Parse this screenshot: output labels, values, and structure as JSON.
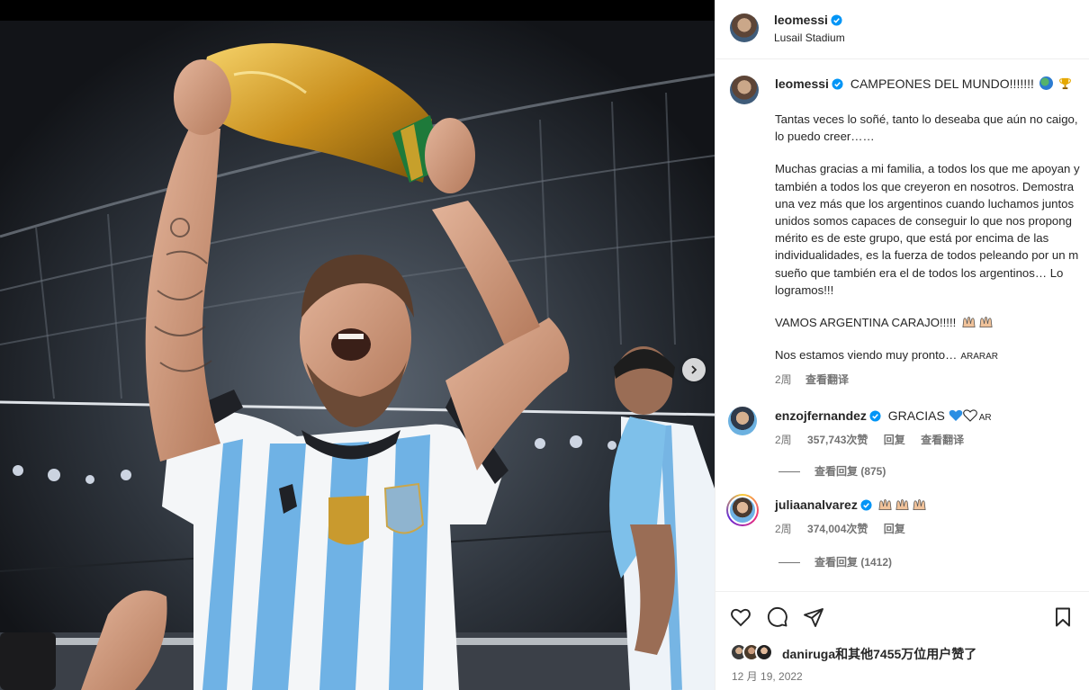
{
  "post": {
    "author": "leomessi",
    "location": "Lusail Stadium",
    "caption_title": "CAMPEONES DEL MUNDO!!!!!!!",
    "caption_lines": [
      "Tantas veces lo soñé, tanto lo deseaba que aún no caigo,",
      "lo puedo creer……",
      "",
      "Muchas gracias a mi familia, a todos los que me apoyan y",
      "también a todos los que creyeron en nosotros. Demostra",
      "una vez más que los argentinos cuando luchamos juntos",
      "unidos somos capaces de conseguir lo que nos propong",
      "mérito es de este grupo, que está por encima de las",
      "individualidades, es la fuerza de todos peleando por un m",
      "sueño que también era el de todos los argentinos… Lo",
      "logramos!!!",
      "",
      "VAMOS ARGENTINA CARAJO!!!!!",
      "",
      "Nos estamos viendo muy pronto…"
    ],
    "caption_tail_note": "ARARAR",
    "caption_age": "2周",
    "caption_translate": "查看翻译"
  },
  "comments": [
    {
      "user": "enzojfernandez",
      "text": "GRACIAS",
      "suffix": "AR",
      "age": "2周",
      "likes": "357,743次赞",
      "reply": "回复",
      "translate": "查看翻译",
      "view_replies": "查看回复 (875)"
    },
    {
      "user": "juliaanalvarez",
      "text": "",
      "age": "2周",
      "likes": "374,004次赞",
      "reply": "回复",
      "view_replies": "查看回复 (1412)"
    }
  ],
  "actions": {
    "icons": [
      "heart-icon",
      "comment-icon",
      "share-icon",
      "bookmark-icon"
    ]
  },
  "likes_summary": "daniruga和其他7455万位用户赞了",
  "post_date": "12 月 19, 2022",
  "colors": {
    "verified": "#0095f6",
    "muted": "#737373",
    "text": "#262626"
  }
}
